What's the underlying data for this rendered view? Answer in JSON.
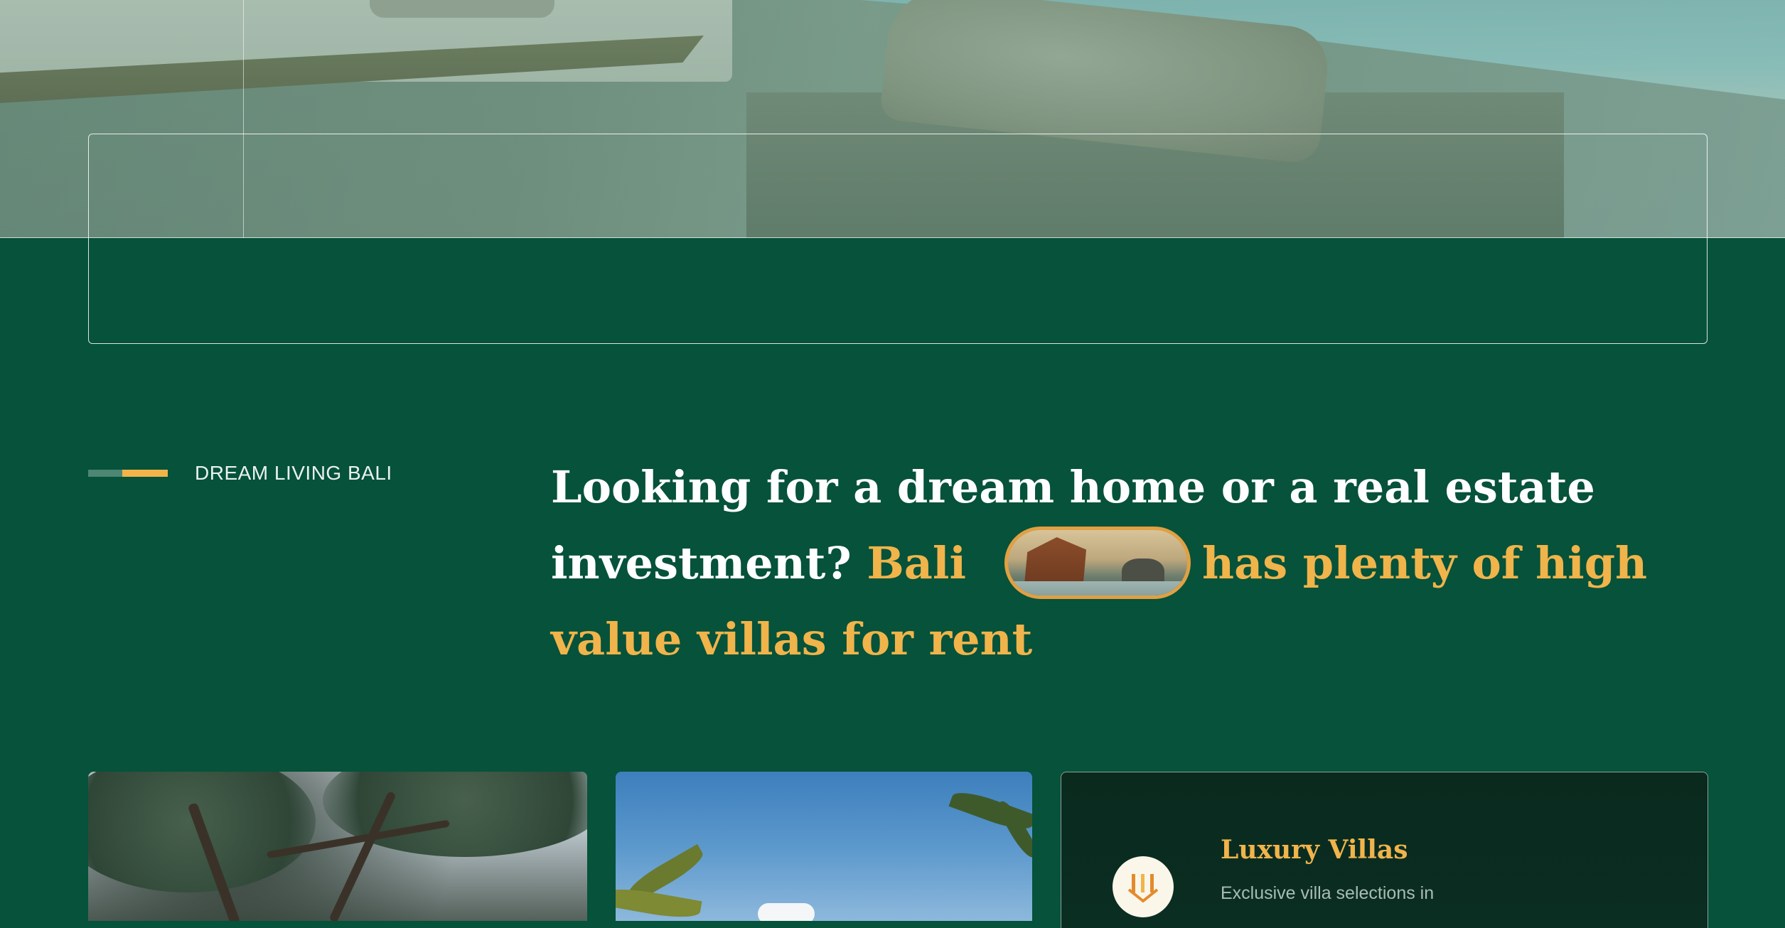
{
  "intro": {
    "eyebrow_label": "DREAM LIVING BALI",
    "headline_part1": "Looking for a dream home or a real estate investment?",
    "headline_accent1": "Bali",
    "headline_accent2": "has plenty of high value villas for rent"
  },
  "cards": {
    "feature": {
      "title": "Luxury Villas",
      "description": "Exclusive villa selections in"
    }
  },
  "colors": {
    "background": "#06523a",
    "accent": "#f0b44b",
    "text": "#ffffff"
  },
  "icons": {
    "eyebrow_bar": "accent-bar",
    "feature_icon": "villa-download-icon"
  }
}
